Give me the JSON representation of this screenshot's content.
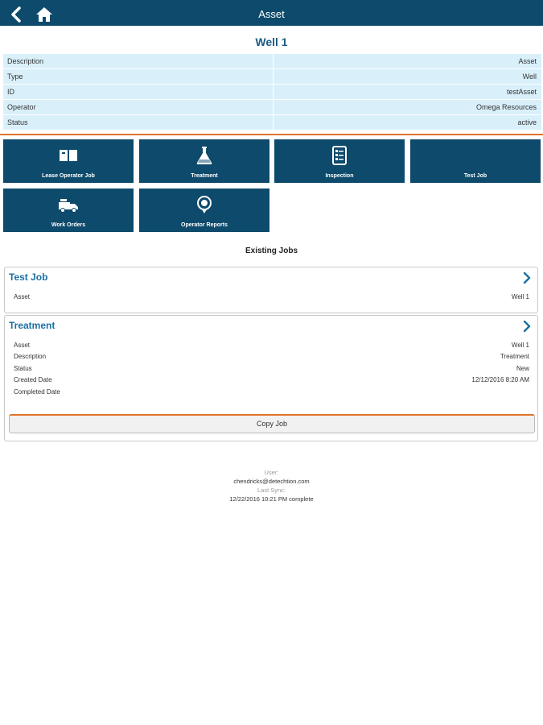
{
  "header": {
    "title": "Asset"
  },
  "asset": {
    "name": "Well 1",
    "properties": [
      {
        "label": "Description",
        "value": "Asset"
      },
      {
        "label": "Type",
        "value": "Well"
      },
      {
        "label": "ID",
        "value": "testAsset"
      },
      {
        "label": "Operator",
        "value": "Omega Resources"
      },
      {
        "label": "Status",
        "value": "active"
      }
    ]
  },
  "actions": [
    {
      "label": "Lease Operator Job",
      "icon": "book-icon"
    },
    {
      "label": "Treatment",
      "icon": "flask-icon"
    },
    {
      "label": "Inspection",
      "icon": "checklist-icon"
    },
    {
      "label": "Test Job",
      "icon": ""
    },
    {
      "label": "Work Orders",
      "icon": "truck-icon"
    },
    {
      "label": "Operator Reports",
      "icon": "report-badge-icon"
    }
  ],
  "existing_jobs": {
    "heading": "Existing Jobs",
    "jobs": [
      {
        "title": "Test Job",
        "fields": [
          {
            "label": "Asset",
            "value": "Well 1"
          }
        ]
      },
      {
        "title": "Treatment",
        "fields": [
          {
            "label": "Asset",
            "value": "Well 1"
          },
          {
            "label": "Description",
            "value": "Treatment"
          },
          {
            "label": "Status",
            "value": "New"
          },
          {
            "label": "Created Date",
            "value": "12/12/2016 8:20 AM"
          },
          {
            "label": "Completed Date",
            "value": ""
          }
        ],
        "button": "Copy Job"
      }
    ]
  },
  "footer": {
    "user_label": "User:",
    "user_email": "chendricks@detechtion.com",
    "sync_label": "Last Sync:",
    "sync_value": "12/22/2016 10:21 PM complete"
  },
  "colors": {
    "primary": "#0d4a6b",
    "accent": "#e0742c",
    "row_bg": "#d9f0fb",
    "link": "#1b6fa3"
  }
}
